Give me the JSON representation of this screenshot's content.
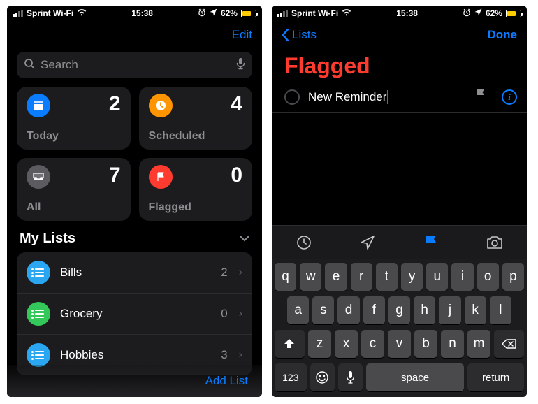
{
  "status": {
    "carrier": "Sprint Wi-Fi",
    "time": "15:38",
    "battery_pct": "62%",
    "battery_fill_pct": 62
  },
  "left": {
    "edit": "Edit",
    "search_placeholder": "Search",
    "tiles": {
      "today": {
        "label": "Today",
        "count": "2",
        "color": "#0a7cff"
      },
      "scheduled": {
        "label": "Scheduled",
        "count": "4",
        "color": "#ff9500"
      },
      "all": {
        "label": "All",
        "count": "7",
        "color": "#5b5b60"
      },
      "flagged": {
        "label": "Flagged",
        "count": "0",
        "color": "#ff3b30"
      }
    },
    "section_title": "My Lists",
    "lists": [
      {
        "name": "Bills",
        "count": "2",
        "color": "#2aa7f0"
      },
      {
        "name": "Grocery",
        "count": "0",
        "color": "#34c759"
      },
      {
        "name": "Hobbies",
        "count": "3",
        "color": "#2aa7f0"
      }
    ],
    "add_list": "Add List"
  },
  "right": {
    "back_label": "Lists",
    "done": "Done",
    "title": "Flagged",
    "new_reminder": "New Reminder",
    "keyboard": {
      "row1": [
        "q",
        "w",
        "e",
        "r",
        "t",
        "y",
        "u",
        "i",
        "o",
        "p"
      ],
      "row2": [
        "a",
        "s",
        "d",
        "f",
        "g",
        "h",
        "j",
        "k",
        "l"
      ],
      "row3": [
        "z",
        "x",
        "c",
        "v",
        "b",
        "n",
        "m"
      ],
      "numkey": "123",
      "space": "space",
      "return": "return"
    }
  }
}
